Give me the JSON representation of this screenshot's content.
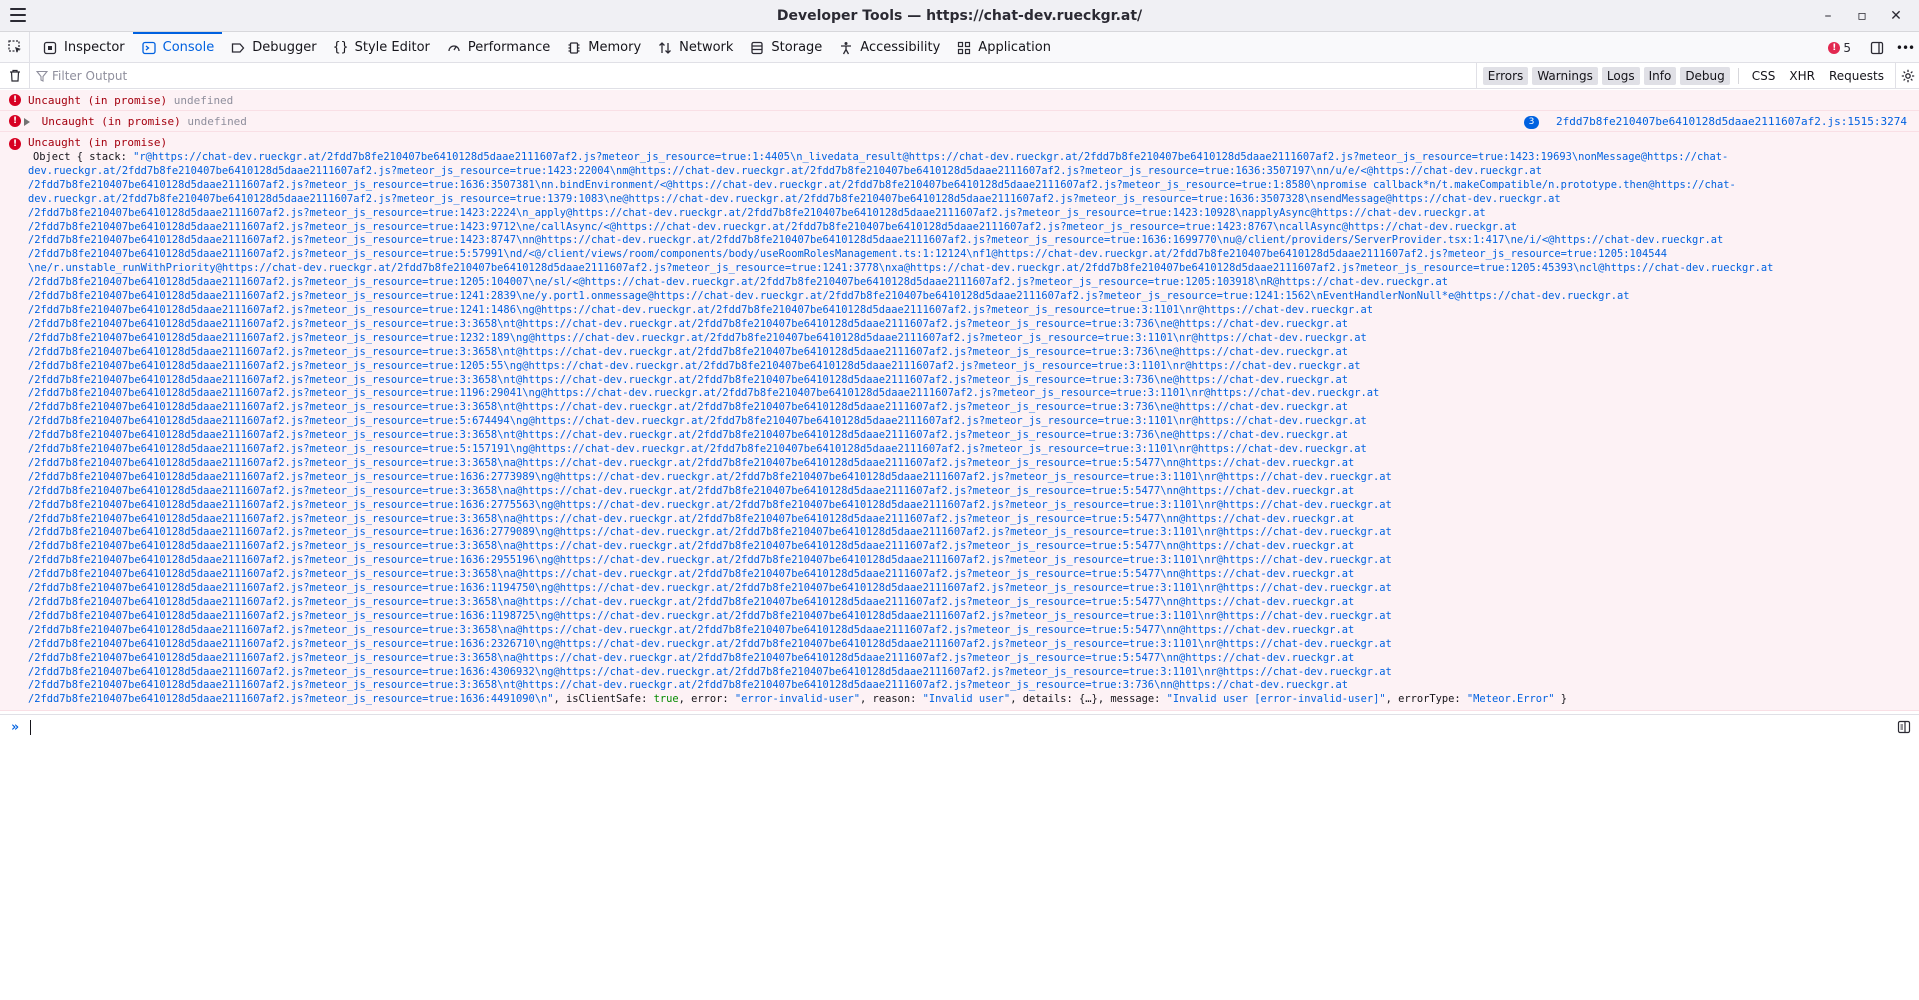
{
  "window": {
    "title": "Developer Tools — https://chat-dev.rueckgr.at/",
    "controls": [
      "–",
      "▫",
      "✕"
    ]
  },
  "tabs": [
    {
      "label": "Inspector",
      "icon": "inspector-icon"
    },
    {
      "label": "Console",
      "icon": "console-icon",
      "selected": true
    },
    {
      "label": "Debugger",
      "icon": "debugger-icon"
    },
    {
      "label": "Style Editor",
      "icon": "style-editor-icon"
    },
    {
      "label": "Performance",
      "icon": "performance-icon"
    },
    {
      "label": "Memory",
      "icon": "memory-icon"
    },
    {
      "label": "Network",
      "icon": "network-icon"
    },
    {
      "label": "Storage",
      "icon": "storage-icon"
    },
    {
      "label": "Accessibility",
      "icon": "accessibility-icon"
    },
    {
      "label": "Application",
      "icon": "application-icon"
    }
  ],
  "toolbar": {
    "error_count": "5",
    "more": "•••"
  },
  "filter": {
    "placeholder": "Filter Output",
    "levels": [
      "Errors",
      "Warnings",
      "Logs",
      "Info",
      "Debug"
    ],
    "types": [
      "CSS",
      "XHR",
      "Requests"
    ]
  },
  "messages": [
    {
      "label": "Uncaught (in promise)",
      "value": "undefined"
    },
    {
      "label": "Uncaught (in promise)",
      "value": "undefined",
      "repeat": "3",
      "location": "2fdd7b8fe210407be6410128d5daae2111607af2.js:1515:3274"
    },
    {
      "label": "Uncaught (in promise)"
    }
  ],
  "stack_lines": [
    "/2fdd7b8fe210407be6410128d5daae2111607af2.js?meteor_js_resource=true:1423:22004\\nm@https://chat-dev.rueckgr.at/2fdd7b8fe210407be6410128d5daae2111607af2.js?meteor_js_resource=true:1636:3507197\\nn/u/e/<@https://chat-dev.rueckgr.at",
    "/2fdd7b8fe210407be6410128d5daae2111607af2.js?meteor_js_resource=true:1636:3507381\\nn.bindEnvironment/<@https://chat-dev.rueckgr.at/2fdd7b8fe210407be6410128d5daae2111607af2.js?meteor_js_resource=true:1:8580\\npromise callback*n/t.makeCompatible/n.prototype.then@https://chat-",
    "dev.rueckgr.at/2fdd7b8fe210407be6410128d5daae2111607af2.js?meteor_js_resource=true:1379:1083\\ne@https://chat-dev.rueckgr.at/2fdd7b8fe210407be6410128d5daae2111607af2.js?meteor_js_resource=true:1636:3507328\\nsendMessage@https://chat-dev.rueckgr.at",
    "/2fdd7b8fe210407be6410128d5daae2111607af2.js?meteor_js_resource=true:1423:2224\\n_apply@https://chat-dev.rueckgr.at/2fdd7b8fe210407be6410128d5daae2111607af2.js?meteor_js_resource=true:1423:10928\\napplyAsync@https://chat-dev.rueckgr.at",
    "/2fdd7b8fe210407be6410128d5daae2111607af2.js?meteor_js_resource=true:1423:9712\\ne/callAsync/<@https://chat-dev.rueckgr.at/2fdd7b8fe210407be6410128d5daae2111607af2.js?meteor_js_resource=true:1423:8767\\ncallAsync@https://chat-dev.rueckgr.at",
    "/2fdd7b8fe210407be6410128d5daae2111607af2.js?meteor_js_resource=true:1423:8747\\nn@https://chat-dev.rueckgr.at/2fdd7b8fe210407be6410128d5daae2111607af2.js?meteor_js_resource=true:1636:1699770\\nu@/client/providers/ServerProvider.tsx:1:417\\ne/i/<@https://chat-dev.rueckgr.at",
    "/2fdd7b8fe210407be6410128d5daae2111607af2.js?meteor_js_resource=true:5:57991\\nd/<@/client/views/room/components/body/useRoomRolesManagement.ts:1:12124\\nf1@https://chat-dev.rueckgr.at/2fdd7b8fe210407be6410128d5daae2111607af2.js?meteor_js_resource=true:1205:104544",
    "\\ne/r.unstable_runWithPriority@https://chat-dev.rueckgr.at/2fdd7b8fe210407be6410128d5daae2111607af2.js?meteor_js_resource=true:1241:3778\\nxa@https://chat-dev.rueckgr.at/2fdd7b8fe210407be6410128d5daae2111607af2.js?meteor_js_resource=true:1205:45393\\ncl@https://chat-dev.rueckgr.at",
    "/2fdd7b8fe210407be6410128d5daae2111607af2.js?meteor_js_resource=true:1205:104007\\ne/sl/<@https://chat-dev.rueckgr.at/2fdd7b8fe210407be6410128d5daae2111607af2.js?meteor_js_resource=true:1205:103918\\nR@https://chat-dev.rueckgr.at",
    "/2fdd7b8fe210407be6410128d5daae2111607af2.js?meteor_js_resource=true:1241:2839\\ne/y.port1.onmessage@https://chat-dev.rueckgr.at/2fdd7b8fe210407be6410128d5daae2111607af2.js?meteor_js_resource=true:1241:1562\\nEventHandlerNonNull*e@https://chat-dev.rueckgr.at",
    "/2fdd7b8fe210407be6410128d5daae2111607af2.js?meteor_js_resource=true:1241:1486\\ng@https://chat-dev.rueckgr.at/2fdd7b8fe210407be6410128d5daae2111607af2.js?meteor_js_resource=true:3:1101\\nr@https://chat-dev.rueckgr.at",
    "/2fdd7b8fe210407be6410128d5daae2111607af2.js?meteor_js_resource=true:3:3658\\nt@https://chat-dev.rueckgr.at/2fdd7b8fe210407be6410128d5daae2111607af2.js?meteor_js_resource=true:3:736\\ne@https://chat-dev.rueckgr.at",
    "/2fdd7b8fe210407be6410128d5daae2111607af2.js?meteor_js_resource=true:1232:189\\ng@https://chat-dev.rueckgr.at/2fdd7b8fe210407be6410128d5daae2111607af2.js?meteor_js_resource=true:3:1101\\nr@https://chat-dev.rueckgr.at",
    "/2fdd7b8fe210407be6410128d5daae2111607af2.js?meteor_js_resource=true:3:3658\\nt@https://chat-dev.rueckgr.at/2fdd7b8fe210407be6410128d5daae2111607af2.js?meteor_js_resource=true:3:736\\ne@https://chat-dev.rueckgr.at",
    "/2fdd7b8fe210407be6410128d5daae2111607af2.js?meteor_js_resource=true:1205:55\\ng@https://chat-dev.rueckgr.at/2fdd7b8fe210407be6410128d5daae2111607af2.js?meteor_js_resource=true:3:1101\\nr@https://chat-dev.rueckgr.at",
    "/2fdd7b8fe210407be6410128d5daae2111607af2.js?meteor_js_resource=true:3:3658\\nt@https://chat-dev.rueckgr.at/2fdd7b8fe210407be6410128d5daae2111607af2.js?meteor_js_resource=true:3:736\\ne@https://chat-dev.rueckgr.at",
    "/2fdd7b8fe210407be6410128d5daae2111607af2.js?meteor_js_resource=true:1196:29041\\ng@https://chat-dev.rueckgr.at/2fdd7b8fe210407be6410128d5daae2111607af2.js?meteor_js_resource=true:3:1101\\nr@https://chat-dev.rueckgr.at",
    "/2fdd7b8fe210407be6410128d5daae2111607af2.js?meteor_js_resource=true:3:3658\\nt@https://chat-dev.rueckgr.at/2fdd7b8fe210407be6410128d5daae2111607af2.js?meteor_js_resource=true:3:736\\ne@https://chat-dev.rueckgr.at",
    "/2fdd7b8fe210407be6410128d5daae2111607af2.js?meteor_js_resource=true:5:674494\\ng@https://chat-dev.rueckgr.at/2fdd7b8fe210407be6410128d5daae2111607af2.js?meteor_js_resource=true:3:1101\\nr@https://chat-dev.rueckgr.at",
    "/2fdd7b8fe210407be6410128d5daae2111607af2.js?meteor_js_resource=true:3:3658\\nt@https://chat-dev.rueckgr.at/2fdd7b8fe210407be6410128d5daae2111607af2.js?meteor_js_resource=true:3:736\\ne@https://chat-dev.rueckgr.at",
    "/2fdd7b8fe210407be6410128d5daae2111607af2.js?meteor_js_resource=true:5:157191\\ng@https://chat-dev.rueckgr.at/2fdd7b8fe210407be6410128d5daae2111607af2.js?meteor_js_resource=true:3:1101\\nr@https://chat-dev.rueckgr.at",
    "/2fdd7b8fe210407be6410128d5daae2111607af2.js?meteor_js_resource=true:3:3658\\na@https://chat-dev.rueckgr.at/2fdd7b8fe210407be6410128d5daae2111607af2.js?meteor_js_resource=true:5:5477\\nn@https://chat-dev.rueckgr.at",
    "/2fdd7b8fe210407be6410128d5daae2111607af2.js?meteor_js_resource=true:1636:2773989\\ng@https://chat-dev.rueckgr.at/2fdd7b8fe210407be6410128d5daae2111607af2.js?meteor_js_resource=true:3:1101\\nr@https://chat-dev.rueckgr.at",
    "/2fdd7b8fe210407be6410128d5daae2111607af2.js?meteor_js_resource=true:3:3658\\na@https://chat-dev.rueckgr.at/2fdd7b8fe210407be6410128d5daae2111607af2.js?meteor_js_resource=true:5:5477\\nn@https://chat-dev.rueckgr.at",
    "/2fdd7b8fe210407be6410128d5daae2111607af2.js?meteor_js_resource=true:1636:2775563\\ng@https://chat-dev.rueckgr.at/2fdd7b8fe210407be6410128d5daae2111607af2.js?meteor_js_resource=true:3:1101\\nr@https://chat-dev.rueckgr.at",
    "/2fdd7b8fe210407be6410128d5daae2111607af2.js?meteor_js_resource=true:3:3658\\na@https://chat-dev.rueckgr.at/2fdd7b8fe210407be6410128d5daae2111607af2.js?meteor_js_resource=true:5:5477\\nn@https://chat-dev.rueckgr.at",
    "/2fdd7b8fe210407be6410128d5daae2111607af2.js?meteor_js_resource=true:1636:2779089\\ng@https://chat-dev.rueckgr.at/2fdd7b8fe210407be6410128d5daae2111607af2.js?meteor_js_resource=true:3:1101\\nr@https://chat-dev.rueckgr.at",
    "/2fdd7b8fe210407be6410128d5daae2111607af2.js?meteor_js_resource=true:3:3658\\na@https://chat-dev.rueckgr.at/2fdd7b8fe210407be6410128d5daae2111607af2.js?meteor_js_resource=true:5:5477\\nn@https://chat-dev.rueckgr.at",
    "/2fdd7b8fe210407be6410128d5daae2111607af2.js?meteor_js_resource=true:1636:2955196\\ng@https://chat-dev.rueckgr.at/2fdd7b8fe210407be6410128d5daae2111607af2.js?meteor_js_resource=true:3:1101\\nr@https://chat-dev.rueckgr.at",
    "/2fdd7b8fe210407be6410128d5daae2111607af2.js?meteor_js_resource=true:3:3658\\na@https://chat-dev.rueckgr.at/2fdd7b8fe210407be6410128d5daae2111607af2.js?meteor_js_resource=true:5:5477\\nn@https://chat-dev.rueckgr.at",
    "/2fdd7b8fe210407be6410128d5daae2111607af2.js?meteor_js_resource=true:1636:1194750\\ng@https://chat-dev.rueckgr.at/2fdd7b8fe210407be6410128d5daae2111607af2.js?meteor_js_resource=true:3:1101\\nr@https://chat-dev.rueckgr.at",
    "/2fdd7b8fe210407be6410128d5daae2111607af2.js?meteor_js_resource=true:3:3658\\na@https://chat-dev.rueckgr.at/2fdd7b8fe210407be6410128d5daae2111607af2.js?meteor_js_resource=true:5:5477\\nn@https://chat-dev.rueckgr.at",
    "/2fdd7b8fe210407be6410128d5daae2111607af2.js?meteor_js_resource=true:1636:1198725\\ng@https://chat-dev.rueckgr.at/2fdd7b8fe210407be6410128d5daae2111607af2.js?meteor_js_resource=true:3:1101\\nr@https://chat-dev.rueckgr.at",
    "/2fdd7b8fe210407be6410128d5daae2111607af2.js?meteor_js_resource=true:3:3658\\na@https://chat-dev.rueckgr.at/2fdd7b8fe210407be6410128d5daae2111607af2.js?meteor_js_resource=true:5:5477\\nn@https://chat-dev.rueckgr.at",
    "/2fdd7b8fe210407be6410128d5daae2111607af2.js?meteor_js_resource=true:1636:2326710\\ng@https://chat-dev.rueckgr.at/2fdd7b8fe210407be6410128d5daae2111607af2.js?meteor_js_resource=true:3:1101\\nr@https://chat-dev.rueckgr.at",
    "/2fdd7b8fe210407be6410128d5daae2111607af2.js?meteor_js_resource=true:3:3658\\na@https://chat-dev.rueckgr.at/2fdd7b8fe210407be6410128d5daae2111607af2.js?meteor_js_resource=true:5:5477\\nn@https://chat-dev.rueckgr.at",
    "/2fdd7b8fe210407be6410128d5daae2111607af2.js?meteor_js_resource=true:1636:4306932\\ng@https://chat-dev.rueckgr.at/2fdd7b8fe210407be6410128d5daae2111607af2.js?meteor_js_resource=true:3:1101\\nr@https://chat-dev.rueckgr.at",
    "/2fdd7b8fe210407be6410128d5daae2111607af2.js?meteor_js_resource=true:3:3658\\nt@https://chat-dev.rueckgr.at/2fdd7b8fe210407be6410128d5daae2111607af2.js?meteor_js_resource=true:3:736\\nn@https://chat-dev.rueckgr.at"
  ],
  "object_preview": {
    "head": "Object { stack: ",
    "first_line": "\"r@https://chat-dev.rueckgr.at/2fdd7b8fe210407be6410128d5daae2111607af2.js?meteor_js_resource=true:1:4405\\n_livedata_result@https://chat-dev.rueckgr.at/2fdd7b8fe210407be6410128d5daae2111607af2.js?meteor_js_resource=true:1423:19693\\nonMessage@https://chat-",
    "second_line": "dev.rueckgr.at/2fdd7b8fe210407be6410128d5daae2111607af2.js?meteor_js_resource=true:1423:22004\\nm@https://chat-dev.rueckgr.at/2fdd7b8fe210407be6410128d5daae2111607af2.js?meteor_js_resource=true:1636:3507197\\nn/u/e/<@https://chat-dev.rueckgr.at",
    "last_line_stack": "/2fdd7b8fe210407be6410128d5daae2111607af2.js?meteor_js_resource=true:1636:4491090\\n\"",
    "k_isClientSafe": ", isClientSafe: ",
    "v_isClientSafe": "true",
    "k_error": ", error: ",
    "v_error": "\"error-invalid-user\"",
    "k_reason": ", reason: ",
    "v_reason": "\"Invalid user\"",
    "k_details": ", details: ",
    "v_details": "{…}",
    "k_message": ", message: ",
    "v_message": "\"Invalid user [error-invalid-user]\"",
    "k_errorType": ", errorType: ",
    "v_errorType": "\"Meteor.Error\"",
    "tail": " }"
  }
}
